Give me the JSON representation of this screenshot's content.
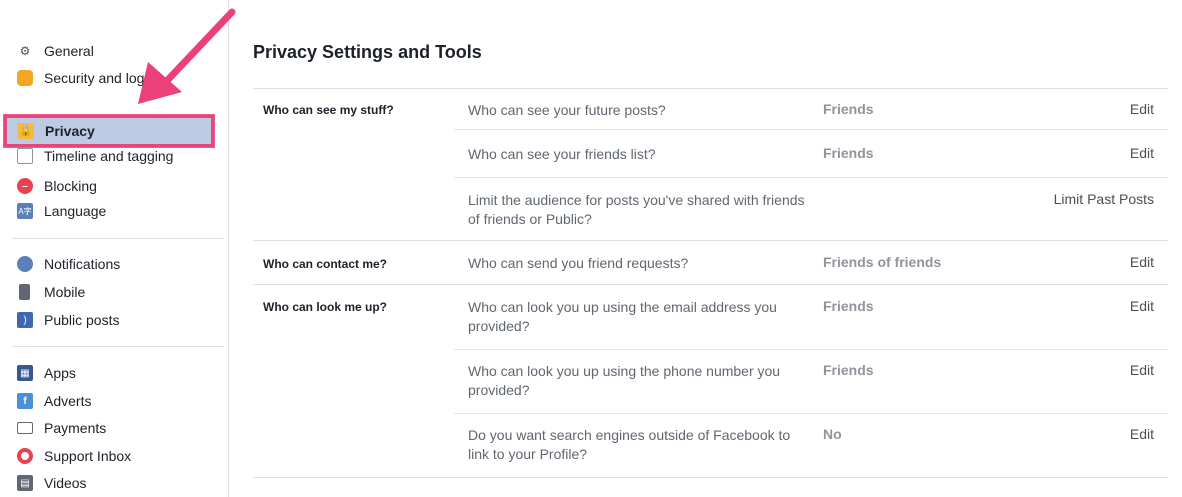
{
  "sidebar": {
    "items": [
      {
        "label": "General",
        "icon": "gears-icon"
      },
      {
        "label": "Security and login",
        "icon": "badge-icon"
      },
      {
        "label": "Privacy",
        "icon": "lock-icon"
      },
      {
        "label": "Timeline and tagging",
        "icon": "timeline-icon"
      },
      {
        "label": "Blocking",
        "icon": "blocking-icon"
      },
      {
        "label": "Language",
        "icon": "language-icon"
      },
      {
        "label": "Notifications",
        "icon": "globe-icon"
      },
      {
        "label": "Mobile",
        "icon": "mobile-icon"
      },
      {
        "label": "Public posts",
        "icon": "rss-icon"
      },
      {
        "label": "Apps",
        "icon": "apps-icon"
      },
      {
        "label": "Adverts",
        "icon": "adverts-icon"
      },
      {
        "label": "Payments",
        "icon": "card-icon"
      },
      {
        "label": "Support Inbox",
        "icon": "lifebuoy-icon"
      },
      {
        "label": "Videos",
        "icon": "film-icon"
      }
    ]
  },
  "main": {
    "title": "Privacy Settings and Tools",
    "sections": [
      {
        "label": "Who can see my stuff?"
      },
      {
        "label": "Who can contact me?"
      },
      {
        "label": "Who can look me up?"
      }
    ],
    "rows": [
      {
        "question": "Who can see your future posts?",
        "value": "Friends",
        "action": "Edit"
      },
      {
        "question": "Who can see your friends list?",
        "value": "Friends",
        "action": "Edit"
      },
      {
        "question": "Limit the audience for posts you've shared with friends of friends or Public?",
        "value": "",
        "action": "Limit Past Posts"
      },
      {
        "question": "Who can send you friend requests?",
        "value": "Friends of friends",
        "action": "Edit"
      },
      {
        "question": "Who can look you up using the email address you provided?",
        "value": "Friends",
        "action": "Edit"
      },
      {
        "question": "Who can look you up using the phone number you provided?",
        "value": "Friends",
        "action": "Edit"
      },
      {
        "question": "Do you want search engines outside of Facebook to link to your Profile?",
        "value": "No",
        "action": "Edit"
      }
    ]
  },
  "colors": {
    "highlight": "#e8457a",
    "active_bg": "#bccbe3"
  }
}
